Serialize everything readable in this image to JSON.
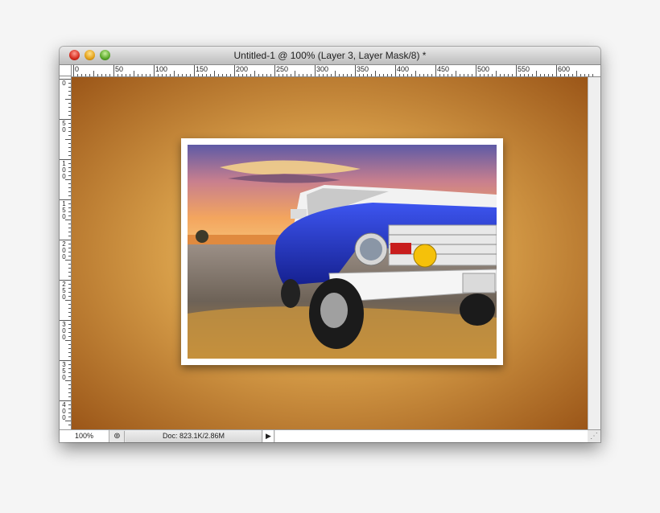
{
  "window": {
    "title": "Untitled-1 @ 100% (Layer 3, Layer Mask/8) *"
  },
  "ruler": {
    "horizontal_labels": [
      "0",
      "50",
      "100",
      "150",
      "200",
      "250",
      "300",
      "350",
      "400",
      "450",
      "500",
      "550",
      "600"
    ],
    "vertical_labels": [
      "0",
      "50",
      "100",
      "150",
      "200",
      "250",
      "300",
      "350",
      "400"
    ]
  },
  "statusbar": {
    "zoom": "100%",
    "doc_info": "Doc: 823.1K/2.86M",
    "arrow": "▶",
    "icon": "⊚"
  },
  "icons": {
    "close": "close-icon",
    "minimize": "minimize-icon",
    "zoom": "zoom-icon",
    "resize": "resize-grip-icon"
  },
  "colors": {
    "canvas_center": "#f5d78f",
    "canvas_edge": "#96501a",
    "truck_body": "#2a3fd1"
  }
}
